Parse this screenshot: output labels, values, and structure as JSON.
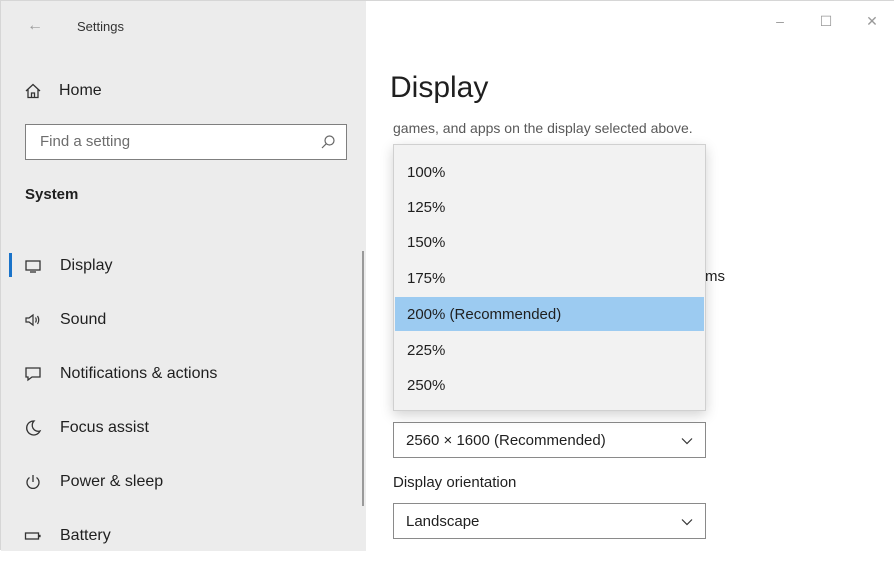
{
  "window": {
    "app_title": "Settings",
    "minimize": "–",
    "maximize": "☐",
    "close": "✕"
  },
  "sidebar": {
    "home_label": "Home",
    "search_placeholder": "Find a setting",
    "section_title": "System",
    "items": [
      {
        "label": "Display",
        "icon": "monitor-icon",
        "active": true
      },
      {
        "label": "Sound",
        "icon": "speaker-icon"
      },
      {
        "label": "Notifications & actions",
        "icon": "notification-icon"
      },
      {
        "label": "Focus assist",
        "icon": "moon-icon"
      },
      {
        "label": "Power & sleep",
        "icon": "power-icon"
      },
      {
        "label": "Battery",
        "icon": "battery-icon"
      }
    ]
  },
  "main": {
    "title": "Display",
    "scale_description_partial": "games, and apps on the display selected above.",
    "partial_text": "ms",
    "scale_options": [
      "100%",
      "125%",
      "150%",
      "175%",
      "200% (Recommended)",
      "225%",
      "250%"
    ],
    "scale_selected_index": 4,
    "resolution_value": "2560 × 1600 (Recommended)",
    "orientation_label": "Display orientation",
    "orientation_value": "Landscape"
  },
  "colors": {
    "accent": "#1a73c9",
    "selected_option": "#9ccbf1",
    "sidebar_bg": "#ececec"
  }
}
